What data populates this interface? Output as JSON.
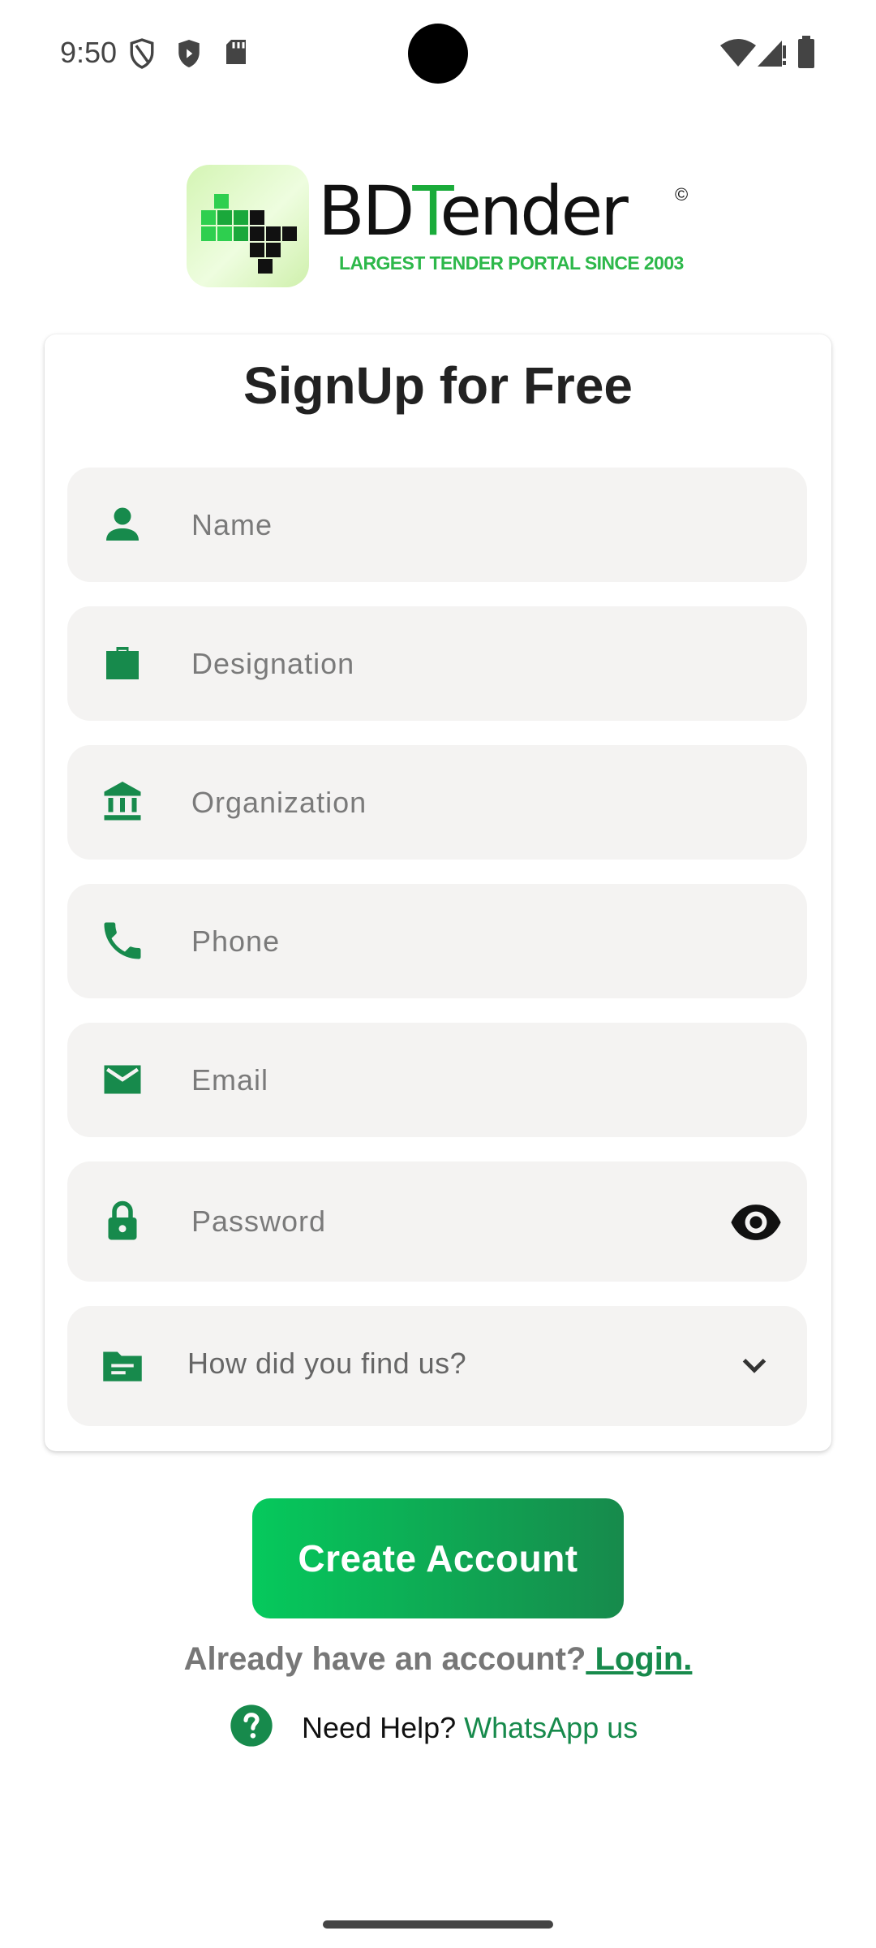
{
  "status_bar": {
    "time": "9:50"
  },
  "brand": {
    "name_prefix": "BD",
    "name_accent": "T",
    "name_suffix": "ender",
    "copyright": "©",
    "tagline": "LARGEST TENDER PORTAL SINCE 2003"
  },
  "form": {
    "title": "SignUp for Free",
    "fields": {
      "name": {
        "placeholder": "Name",
        "icon": "person-icon"
      },
      "designation": {
        "placeholder": "Designation",
        "icon": "briefcase-icon"
      },
      "organization": {
        "placeholder": "Organization",
        "icon": "bank-icon"
      },
      "phone": {
        "placeholder": "Phone",
        "icon": "phone-icon"
      },
      "email": {
        "placeholder": "Email",
        "icon": "mail-icon"
      },
      "password": {
        "placeholder": "Password",
        "icon": "lock-icon",
        "toggle_icon": "eye-icon"
      },
      "source": {
        "value": "How did you find us?",
        "icon": "folder-icon",
        "dropdown_icon": "chevron-down-icon"
      }
    },
    "submit_label": "Create Account"
  },
  "footer": {
    "account_prompt": "Already have an account?",
    "login_label": " Login.",
    "help_prompt": "Need Help?",
    "whatsapp_label": "WhatsApp us"
  },
  "colors": {
    "primary": "#178a4c",
    "button_start": "#05c95c",
    "button_end": "#178a4c",
    "field_bg": "#f4f3f2",
    "logo_green": "#2db84a"
  }
}
